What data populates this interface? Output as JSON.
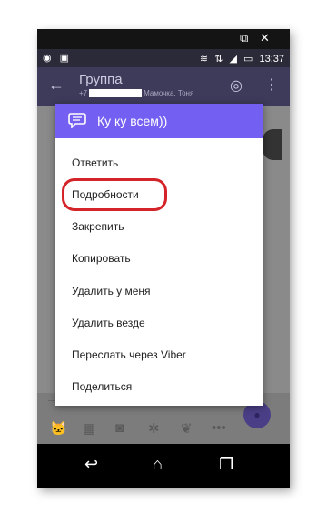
{
  "status_bar": {
    "time": "13:37",
    "battery_icon": "battery-icon",
    "wifi_icon": "wifi-icon"
  },
  "app_bar": {
    "title": "Группа",
    "subtitle_prefix": "+7",
    "subtitle_suffix": "Мамочка, Тоня"
  },
  "dialog": {
    "title": "Ку ку всем))",
    "items": [
      "Ответить",
      "Подробности",
      "Закрепить",
      "Копировать",
      "Удалить у меня",
      "Удалить везде",
      "Переслать через Viber",
      "Поделиться"
    ]
  },
  "colors": {
    "header": "#7360f2",
    "highlight": "#d4242a",
    "appbar": "#3d3a5a"
  }
}
